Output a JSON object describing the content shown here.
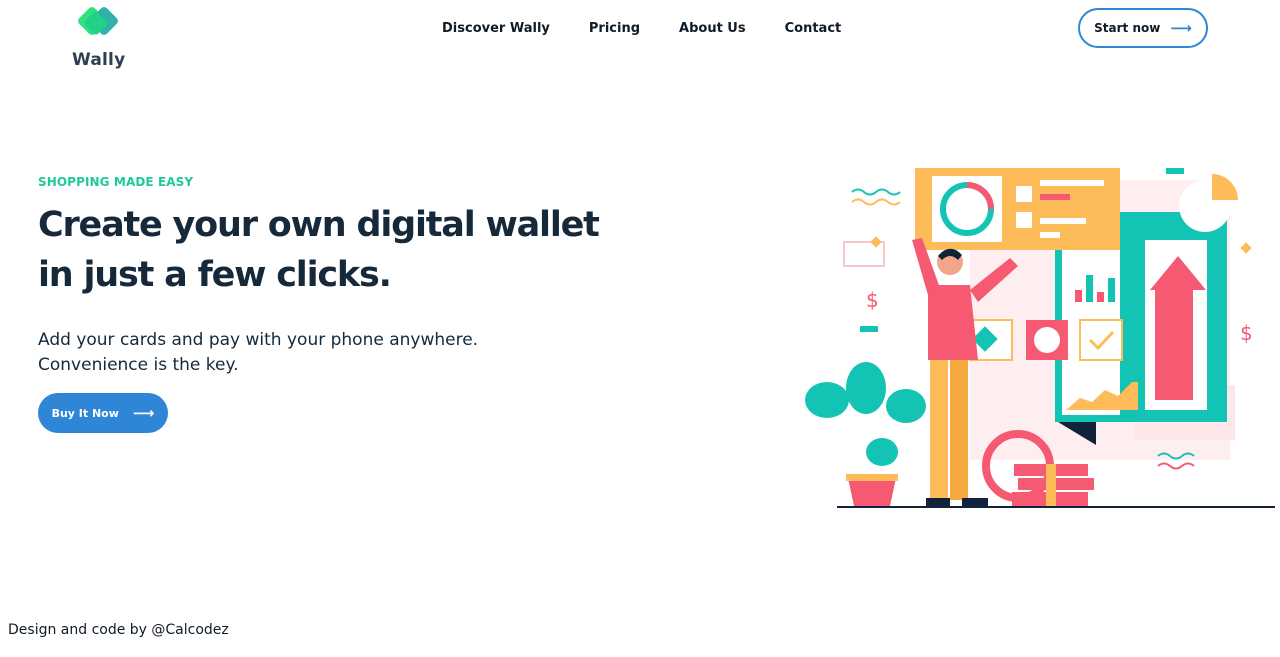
{
  "brand": {
    "name": "Wally",
    "logo_colors": [
      "#2ee27e",
      "#1aa9a0"
    ]
  },
  "nav": {
    "items": [
      {
        "label": "Discover Wally"
      },
      {
        "label": "Pricing"
      },
      {
        "label": "About Us"
      },
      {
        "label": "Contact"
      }
    ]
  },
  "header": {
    "cta_label": "Start now",
    "cta_icon": "arrow-right-icon"
  },
  "hero": {
    "eyebrow": "SHOPPING MADE EASY",
    "title": "Create your own digital wallet in just a few clicks.",
    "subtitle_line1": "Add your cards and pay with your phone anywhere.",
    "subtitle_line2": "Convenience is the key.",
    "button_label": "Buy It Now",
    "button_icon": "arrow-right-icon"
  },
  "footer": {
    "credit": "Design and code by @Calcodez"
  },
  "colors": {
    "accent": "#2f86d6",
    "eyebrow": "#1ec99a",
    "heading": "#15293b",
    "teal": "#13c4b5",
    "coral": "#f55a72",
    "amber": "#fdbb59"
  }
}
